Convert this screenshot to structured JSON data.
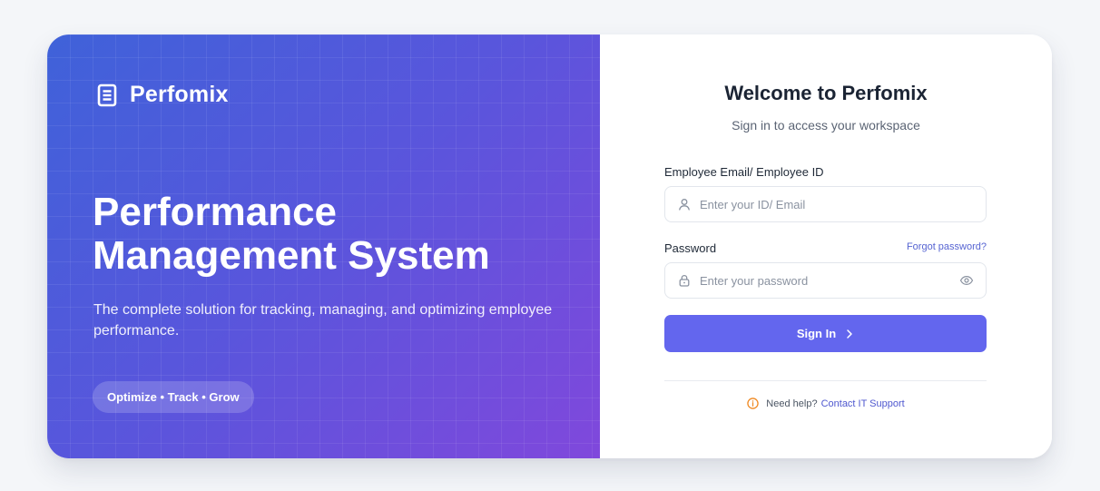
{
  "brand": {
    "name": "Perfomix",
    "icon": "document-list-icon"
  },
  "hero": {
    "headline_line1": "Performance",
    "headline_line2": "Management System",
    "tagline": "The complete solution for tracking, managing, and optimizing employee performance.",
    "pill": "Optimize • Track • Grow"
  },
  "login": {
    "title": "Welcome to Perfomix",
    "subtitle": "Sign in to access your workspace",
    "email_label": "Employee Email/ Employee ID",
    "email_placeholder": "Enter your ID/ Email",
    "email_value": "",
    "password_label": "Password",
    "password_placeholder": "Enter your password",
    "password_value": "",
    "forgot_label": "Forgot password?",
    "signin_label": "Sign In",
    "help_text": "Need help?",
    "help_link": "Contact IT Support"
  },
  "colors": {
    "gradient_start": "#3f62d9",
    "gradient_end": "#8048dc",
    "accent": "#6366ee",
    "link": "#5664d2",
    "info_icon": "#f08a24",
    "page_bg": "#f4f6f9"
  }
}
